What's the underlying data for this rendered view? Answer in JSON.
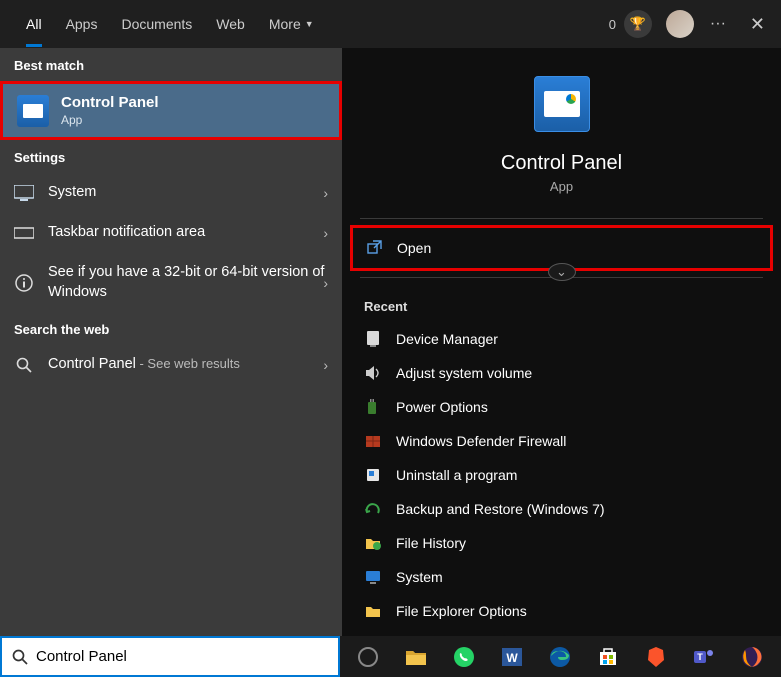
{
  "top": {
    "tabs": [
      "All",
      "Apps",
      "Documents",
      "Web",
      "More"
    ],
    "active_tab": 0,
    "badge": "0"
  },
  "left": {
    "best_match_hdr": "Best match",
    "best": {
      "title": "Control Panel",
      "subtitle": "App"
    },
    "settings_hdr": "Settings",
    "settings": [
      {
        "label": "System"
      },
      {
        "label": "Taskbar notification area"
      },
      {
        "label": "See if you have a 32-bit or 64-bit version of Windows"
      }
    ],
    "web_hdr": "Search the web",
    "web": {
      "label": "Control Panel",
      "suffix": " - See web results"
    }
  },
  "right": {
    "title": "Control Panel",
    "subtitle": "App",
    "open_label": "Open",
    "recent_hdr": "Recent",
    "recent": [
      "Device Manager",
      "Adjust system volume",
      "Power Options",
      "Windows Defender Firewall",
      "Uninstall a program",
      "Backup and Restore (Windows 7)",
      "File History",
      "System",
      "File Explorer Options"
    ]
  },
  "search": {
    "value": "Control Panel"
  },
  "colors": {
    "accent": "#0078d4",
    "highlight": "#e60000"
  }
}
